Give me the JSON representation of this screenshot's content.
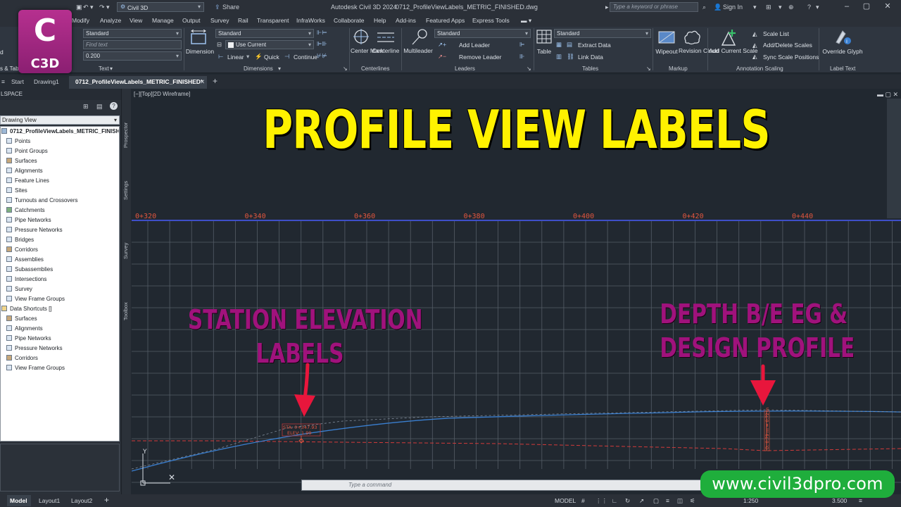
{
  "titlebar": {
    "workspace": "Civil 3D",
    "share": "Share",
    "app_title": "Autodesk Civil 3D 2024",
    "file_title": "0712_ProfileViewLabels_METRIC_FINISHED.dwg",
    "search_placeholder": "Type a keyword or phrase",
    "sign_in": "Sign In"
  },
  "menu": [
    "Modify",
    "Analyze",
    "View",
    "Manage",
    "Output",
    "Survey",
    "Rail",
    "Transparent",
    "InfraWorks",
    "Collaborate",
    "Help",
    "Add-ins",
    "Featured Apps",
    "Express Tools"
  ],
  "ribbon": {
    "text_panel": {
      "style": "Standard",
      "find": "Find text",
      "height": "0.200",
      "title": "Text",
      "left_cut": "d",
      "left_cut2": "s & Tab"
    },
    "dimensions_panel": {
      "dimension": "Dimension",
      "style": "Standard",
      "layer": "Use Current",
      "linear": "Linear",
      "quick": "Quick",
      "continue": "Continue",
      "title": "Dimensions"
    },
    "centerlines_panel": {
      "center_mark": "Center Mark",
      "centerline": "Centerline",
      "title": "Centerlines"
    },
    "leaders_panel": {
      "multileader": "Multileader",
      "style": "Standard",
      "add": "Add Leader",
      "remove": "Remove Leader",
      "title": "Leaders"
    },
    "tables_panel": {
      "table": "Table",
      "style": "Standard",
      "extract": "Extract Data",
      "link": "Link Data",
      "title": "Tables"
    },
    "markup_panel": {
      "wipeout": "Wipeout",
      "revision": "Revision Cloud",
      "title": "Markup"
    },
    "scaling_panel": {
      "add_scale": "Add Current Scale",
      "scale_list": "Scale List",
      "add_delete": "Add/Delete Scales",
      "sync": "Sync Scale Positions",
      "title": "Annotation Scaling"
    },
    "labeltext_panel": {
      "override": "Override Glyph",
      "title": "Label Text"
    }
  },
  "logo": {
    "letter": "C",
    "product": "C3D"
  },
  "tabs": [
    "Start",
    "Drawing1",
    "0712_ProfileViewLabels_METRIC_FINISHED*"
  ],
  "toolspace": {
    "header": "LSPACE",
    "view": "Drawing View",
    "root": "0712_ProfileViewLabels_METRIC_FINISH...",
    "items": [
      "Points",
      "Point Groups",
      "Surfaces",
      "Alignments",
      "Feature Lines",
      "Sites",
      "Turnouts and Crossovers",
      "Catchments",
      "Pipe Networks",
      "Pressure Networks",
      "Bridges",
      "Corridors",
      "Assemblies",
      "Subassemblies",
      "Intersections",
      "Survey",
      "View Frame Groups"
    ],
    "shortcuts": "Data Shortcuts []",
    "shortcut_items": [
      "Surfaces",
      "Alignments",
      "Pipe Networks",
      "Pressure Networks",
      "Corridors",
      "View Frame Groups"
    ],
    "side_tabs": [
      "Prospector",
      "Settings",
      "Survey",
      "Toolbox"
    ]
  },
  "viewport": {
    "label": "[−][Top][2D Wireframe]",
    "title": "PROFILE VIEW LABELS",
    "stations": [
      "0+320",
      "0+340",
      "0+360",
      "0+380",
      "0+400",
      "0+420",
      "0+440"
    ],
    "annotation_left": [
      "STATION ELEVATION",
      "LABELS"
    ],
    "annotation_right": [
      "DEPTH B/E EG &",
      "DESIGN PROFILE"
    ],
    "sta_label": "STA: 0+347.93",
    "elev_label": "ELEV: 1.99",
    "depth_label": "D: 0.79 m = 0.72 m",
    "axis_y": "Y"
  },
  "command": {
    "placeholder": "Type a command"
  },
  "status": {
    "tabs": [
      "Model",
      "Layout1",
      "Layout2"
    ],
    "model": "MODEL",
    "scale": "1:250",
    "value": "3.500"
  },
  "watermark": "www.civil3dpro.com",
  "colors": {
    "title_yellow": "#fff200",
    "anno_magenta": "#a0127c",
    "station_red": "#e2563f",
    "profile_blue": "#3a7fd0",
    "watermark_green": "#1fae3c"
  }
}
